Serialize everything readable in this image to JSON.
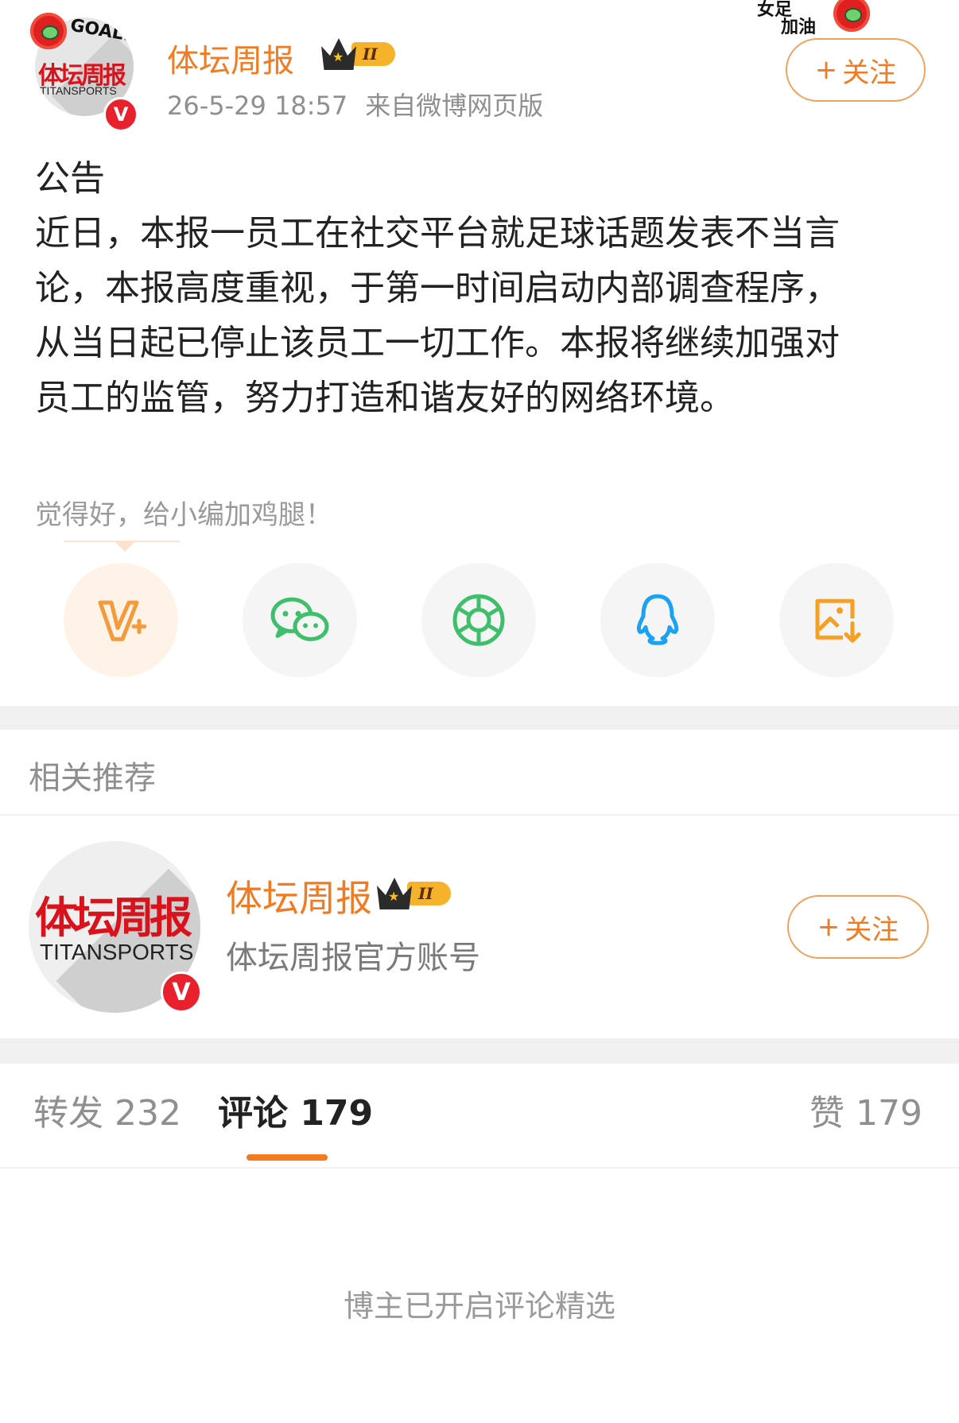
{
  "post_header": {
    "avatar": {
      "cn_text": "体坛周报",
      "en_text": "TITANSPORTS",
      "sticker_text": "GOAL!"
    },
    "username": "体坛周报",
    "level_badge": "II",
    "date": "26-5-29 18:57",
    "source": "来自微博网页版",
    "follow_label": "关注",
    "corner_sticker": [
      "女足",
      "加油"
    ]
  },
  "post": {
    "lines": [
      "公告",
      "近日，本报一员工在社交平台就足球话题发表不当言",
      "论，本报高度重视，于第一时间启动内部调查程序，",
      "从当日起已停止该员工一切工作。本报将继续加强对",
      "员工的监管，努力打造和谐友好的网络环境。"
    ]
  },
  "reward_tip": "觉得好，给小编加鸡腿！",
  "share_buttons": [
    {
      "name": "v-plus-icon",
      "color": "#f39a3c"
    },
    {
      "name": "wechat-icon",
      "color": "#3fbf6b"
    },
    {
      "name": "moments-icon",
      "color": "#3fbf6b"
    },
    {
      "name": "qq-icon",
      "color": "#1da1f2"
    },
    {
      "name": "save-image-icon",
      "color": "#f3a024"
    }
  ],
  "related": {
    "title": "相关推荐",
    "item": {
      "name": "体坛周报",
      "level_badge": "II",
      "description": "体坛周报官方账号",
      "follow_label": "关注",
      "avatar_cn": "体坛周报",
      "avatar_en": "TITANSPORTS"
    }
  },
  "tabs": {
    "repost": "转发 232",
    "comments": "评论 179",
    "likes": "赞 179"
  },
  "comments_note": "博主已开启评论精选",
  "colors": {
    "accent": "#f27b21",
    "verified_red": "#e9212c"
  }
}
